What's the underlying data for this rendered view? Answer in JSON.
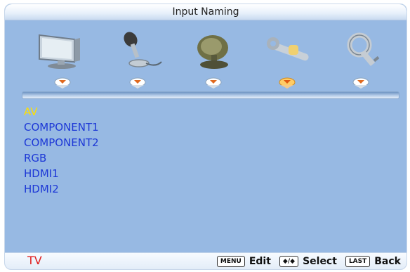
{
  "title": "Input Naming",
  "menu_icons": [
    {
      "name": "monitor-icon"
    },
    {
      "name": "microphone-icon"
    },
    {
      "name": "satellite-dish-icon"
    },
    {
      "name": "wrench-icon"
    },
    {
      "name": "key-icon"
    }
  ],
  "selected_menu_index": 3,
  "inputs": [
    {
      "label": "AV",
      "active": true
    },
    {
      "label": "COMPONENT1",
      "active": false
    },
    {
      "label": "COMPONENT2",
      "active": false
    },
    {
      "label": "RGB",
      "active": false
    },
    {
      "label": "HDMI1",
      "active": false
    },
    {
      "label": "HDMI2",
      "active": false
    }
  ],
  "footer": {
    "source": "TV",
    "menu_key": "MENU",
    "edit_label": "Edit",
    "nav_key": "◆/◆",
    "select_label": "Select",
    "last_key": "LAST",
    "back_label": "Back"
  },
  "colors": {
    "background": "#97b9e3",
    "item_text": "#1d38d6",
    "active_text": "#ffe000",
    "source_text": "#e02020",
    "selector_active": "#f0a030"
  }
}
